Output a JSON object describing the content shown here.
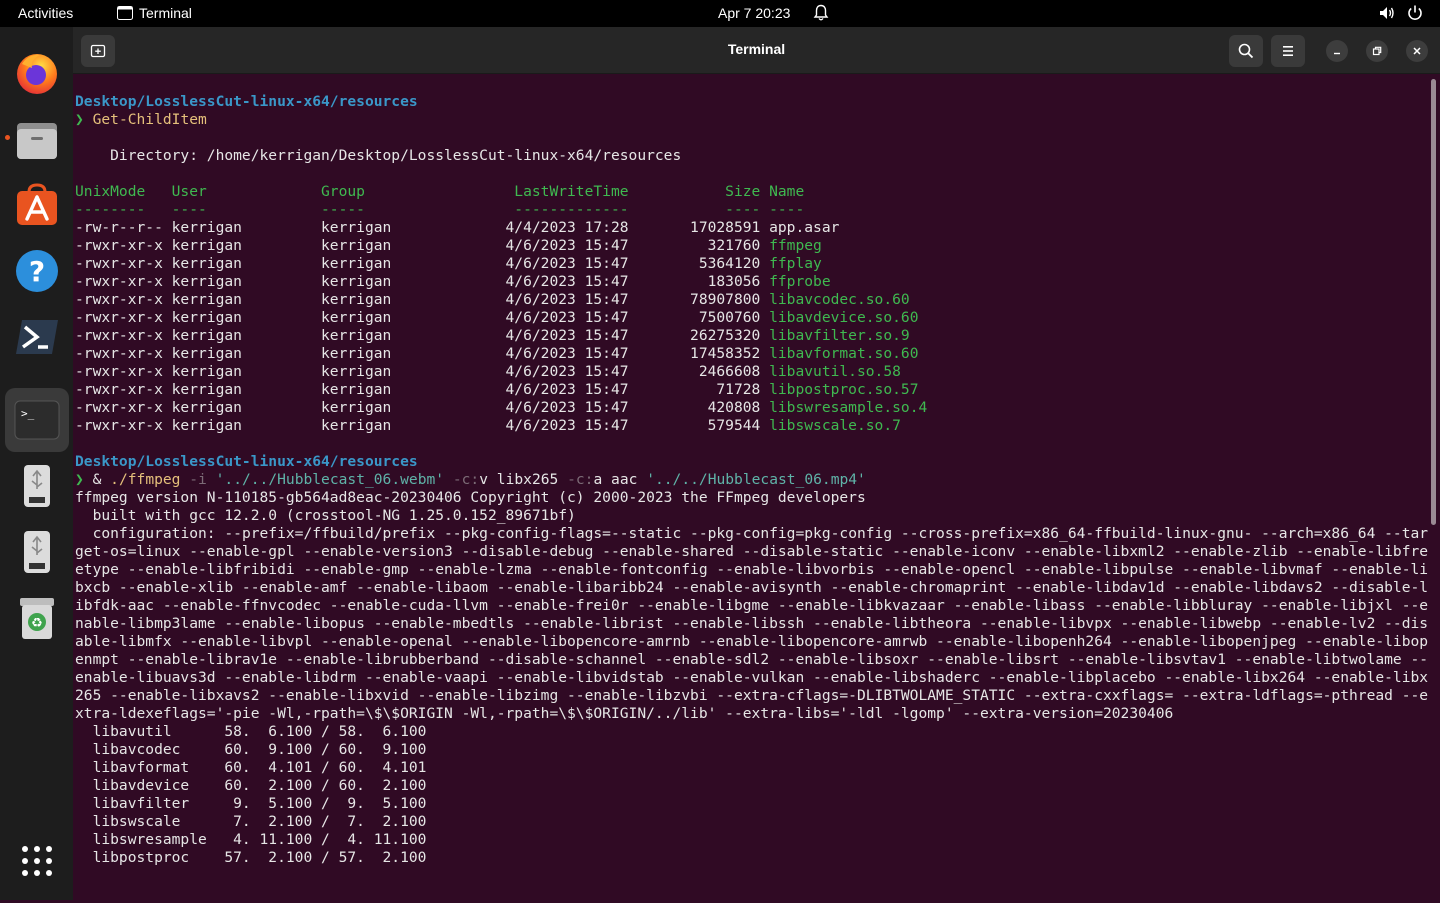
{
  "topbar": {
    "activities": "Activities",
    "app_name": "Terminal",
    "clock": "Apr 7  20:23"
  },
  "dock": {
    "items": [
      {
        "name": "firefox"
      },
      {
        "name": "files"
      },
      {
        "name": "ubuntu-software"
      },
      {
        "name": "help"
      },
      {
        "name": "powershell"
      },
      {
        "name": "terminal"
      },
      {
        "name": "usb-drive-1"
      },
      {
        "name": "usb-drive-2"
      },
      {
        "name": "trash"
      },
      {
        "name": "show-apps"
      }
    ]
  },
  "window": {
    "title": "Terminal"
  },
  "terminal": {
    "prompt1_path": "Desktop/LosslessCut-linux-x64/resources",
    "prompt_symbol": "❯",
    "cmd1": "Get-ChildItem",
    "directory_line": "    Directory: /home/kerrigan/Desktop/LosslessCut-linux-x64/resources",
    "header": "UnixMode   User             Group                 LastWriteTime           Size Name",
    "header_underline": "--------   ----             -----                 -------------           ---- ----",
    "files": [
      {
        "prefix": "-rw-r--r-- kerrigan         kerrigan             4/4/2023 17:28       17028591 ",
        "name": "app.asar",
        "exec": false
      },
      {
        "prefix": "-rwxr-xr-x kerrigan         kerrigan             4/6/2023 15:47         321760 ",
        "name": "ffmpeg",
        "exec": true
      },
      {
        "prefix": "-rwxr-xr-x kerrigan         kerrigan             4/6/2023 15:47        5364120 ",
        "name": "ffplay",
        "exec": true
      },
      {
        "prefix": "-rwxr-xr-x kerrigan         kerrigan             4/6/2023 15:47         183056 ",
        "name": "ffprobe",
        "exec": true
      },
      {
        "prefix": "-rwxr-xr-x kerrigan         kerrigan             4/6/2023 15:47       78907800 ",
        "name": "libavcodec.so.60",
        "exec": true
      },
      {
        "prefix": "-rwxr-xr-x kerrigan         kerrigan             4/6/2023 15:47        7500760 ",
        "name": "libavdevice.so.60",
        "exec": true
      },
      {
        "prefix": "-rwxr-xr-x kerrigan         kerrigan             4/6/2023 15:47       26275320 ",
        "name": "libavfilter.so.9",
        "exec": true
      },
      {
        "prefix": "-rwxr-xr-x kerrigan         kerrigan             4/6/2023 15:47       17458352 ",
        "name": "libavformat.so.60",
        "exec": true
      },
      {
        "prefix": "-rwxr-xr-x kerrigan         kerrigan             4/6/2023 15:47        2466608 ",
        "name": "libavutil.so.58",
        "exec": true
      },
      {
        "prefix": "-rwxr-xr-x kerrigan         kerrigan             4/6/2023 15:47          71728 ",
        "name": "libpostproc.so.57",
        "exec": true
      },
      {
        "prefix": "-rwxr-xr-x kerrigan         kerrigan             4/6/2023 15:47         420808 ",
        "name": "libswresample.so.4",
        "exec": true
      },
      {
        "prefix": "-rwxr-xr-x kerrigan         kerrigan             4/6/2023 15:47         579544 ",
        "name": "libswscale.so.7",
        "exec": true
      }
    ],
    "prompt2_path": "Desktop/LosslessCut-linux-x64/resources",
    "cmd2": {
      "amp": "& ",
      "exe": "./ffmpeg",
      "flag_i": " -i ",
      "input": "'../../Hubblecast_06.webm'",
      "flag_cv": " -c:",
      "cv_val": "v libx265 ",
      "flag_ca": "-c:",
      "ca_val": "a aac ",
      "output": "'../../Hubblecast_06.mp4'"
    },
    "version_line": "ffmpeg version N-110185-gb564ad8eac-20230406 Copyright (c) 2000-2023 the FFmpeg developers",
    "built_line": "  built with gcc 12.2.0 (crosstool-NG 1.25.0.152_89671bf)",
    "config_text": "  configuration: --prefix=/ffbuild/prefix --pkg-config-flags=--static --pkg-config=pkg-config --cross-prefix=x86_64-ffbuild-linux-gnu- --arch=x86_64 --target-os=linux --enable-gpl --enable-version3 --disable-debug --enable-shared --disable-static --enable-iconv --enable-libxml2 --enable-zlib --enable-libfreetype --enable-libfribidi --enable-gmp --enable-lzma --enable-fontconfig --enable-libvorbis --enable-opencl --enable-libpulse --enable-libvmaf --enable-libxcb --enable-xlib --enable-amf --enable-libaom --enable-libaribb24 --enable-avisynth --enable-chromaprint --enable-libdav1d --enable-libdavs2 --disable-libfdk-aac --enable-ffnvcodec --enable-cuda-llvm --enable-frei0r --enable-libgme --enable-libkvazaar --enable-libass --enable-libbluray --enable-libjxl --enable-libmp3lame --enable-libopus --enable-mbedtls --enable-librist --enable-libssh --enable-libtheora --enable-libvpx --enable-libwebp --enable-lv2 --disable-libmfx --enable-libvpl --enable-openal --enable-libopencore-amrnb --enable-libopencore-amrwb --enable-libopenh264 --enable-libopenjpeg --enable-libopenmpt --enable-librav1e --enable-librubberband --disable-schannel --enable-sdl2 --enable-libsoxr --enable-libsrt --enable-libsvtav1 --enable-libtwolame --enable-libuavs3d --enable-libdrm --enable-vaapi --enable-libvidstab --enable-vulkan --enable-libshaderc --enable-libplacebo --enable-libx264 --enable-libx265 --enable-libxavs2 --enable-libxvid --enable-libzimg --enable-libzvbi --extra-cflags=-DLIBTWOLAME_STATIC --extra-cxxflags= --extra-ldflags=-pthread --extra-ldexeflags='-pie -Wl,-rpath=\\$\\$ORIGIN -Wl,-rpath=\\$\\$ORIGIN/../lib' --extra-libs='-ldl -lgomp' --extra-version=20230406",
    "libs": [
      "  libavutil      58.  6.100 / 58.  6.100",
      "  libavcodec     60.  9.100 / 60.  9.100",
      "  libavformat    60.  4.101 / 60.  4.101",
      "  libavdevice    60.  2.100 / 60.  2.100",
      "  libavfilter     9.  5.100 /  9.  5.100",
      "  libswscale      7.  2.100 /  7.  2.100",
      "  libswresample   4. 11.100 /  4. 11.100",
      "  libpostproc    57.  2.100 / 57.  2.100"
    ]
  },
  "colors": {
    "terminal_bg": "#300a24",
    "path": "#3a97c8",
    "prompt": "#3fb950",
    "command": "#e5c07b",
    "accent": "#e95420"
  }
}
